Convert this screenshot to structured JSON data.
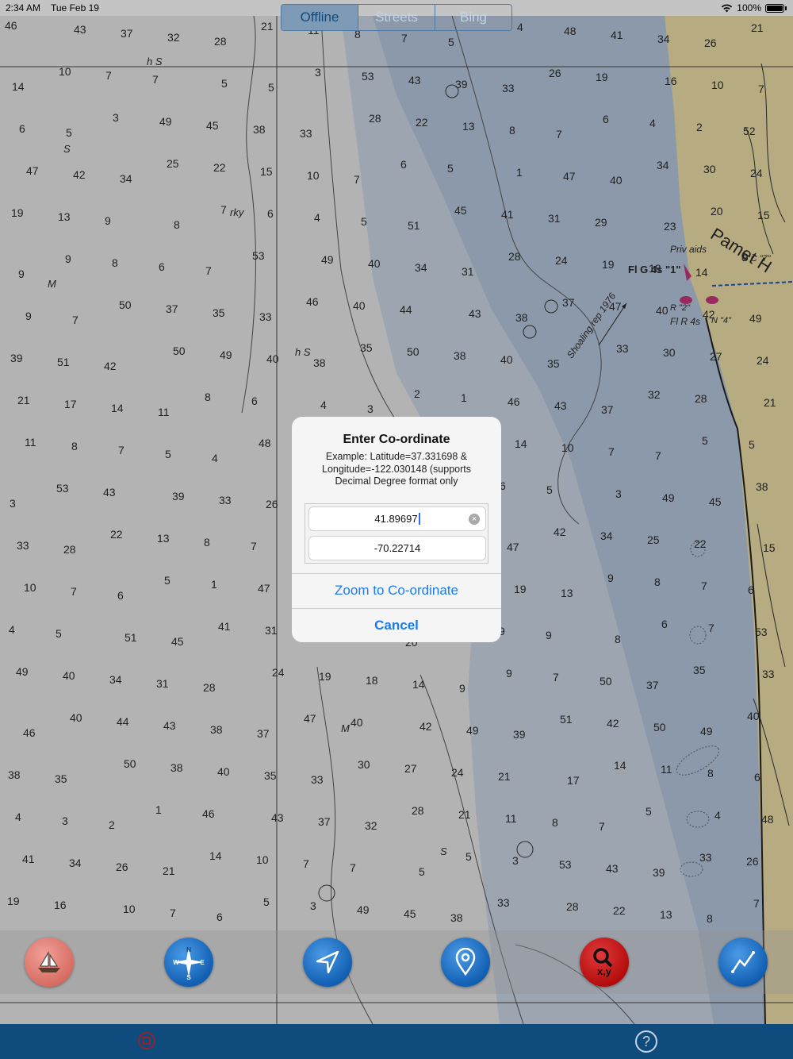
{
  "status_bar": {
    "time": "2:34 AM",
    "date": "Tue Feb 19",
    "battery": "100%"
  },
  "map": {
    "chart_labels": {
      "priv_aids": "Priv aids",
      "light_green": "Fl G 4s \"1\"",
      "light_red": "Fl R 4s",
      "buoy_r2": "R \"2\"",
      "buoy_n4": "N \"4\"",
      "shoaling": "Shoaling rep 1976",
      "place": "Pamet H",
      "gc": "G C \"7\""
    },
    "soundings": [
      "46",
      "43",
      "37",
      "32",
      "28",
      "21",
      "11",
      "8",
      "7",
      "5",
      "4",
      "48",
      "41",
      "34",
      "26",
      "21",
      "14",
      "10",
      "7",
      "7",
      "5",
      "5",
      "3",
      "53",
      "43",
      "39",
      "33",
      "26",
      "19",
      "16",
      "10",
      "7",
      "6",
      "5",
      "3",
      "49",
      "45",
      "38",
      "33",
      "28",
      "22",
      "13",
      "8",
      "7",
      "6",
      "4",
      "2",
      "52",
      "47",
      "42",
      "34",
      "25",
      "22",
      "15",
      "10",
      "7",
      "6",
      "5",
      "1",
      "47",
      "40",
      "34",
      "30",
      "24",
      "19",
      "13",
      "9",
      "8",
      "7",
      "6",
      "4",
      "5",
      "51",
      "45",
      "41",
      "31",
      "29",
      "23",
      "20",
      "15",
      "9",
      "9",
      "8",
      "6",
      "7",
      "53",
      "49",
      "40",
      "34",
      "31",
      "28",
      "24",
      "19",
      "18",
      "14",
      "9",
      "9",
      "7",
      "50",
      "37",
      "35",
      "33",
      "46",
      "40",
      "44",
      "43",
      "38",
      "37",
      "47",
      "40",
      "42",
      "49",
      "39",
      "51",
      "42",
      "50",
      "49",
      "40",
      "38",
      "35",
      "50",
      "38",
      "40",
      "35",
      "33",
      "30",
      "27",
      "24",
      "21",
      "17",
      "14",
      "11",
      "8",
      "6",
      "4",
      "3",
      "2",
      "1"
    ],
    "mini": [
      "h S",
      "M",
      "S",
      "rky"
    ]
  },
  "toolbar": {
    "buttons": [
      {
        "name": "boat-icon"
      },
      {
        "name": "compass-icon"
      },
      {
        "name": "navigate-arrow-icon"
      },
      {
        "name": "map-pin-icon"
      },
      {
        "name": "xy-search-icon",
        "label": "x,y"
      },
      {
        "name": "route-icon"
      }
    ]
  },
  "bottom_bar": {
    "tabs": [
      "Offline",
      "Streets",
      "Bing"
    ],
    "active_tab": "Offline",
    "help": "?"
  },
  "dialog": {
    "title": "Enter Co-ordinate",
    "message": "Example: Latitude=37.331698 & Longitude=-122.030148 (supports Decimal Degree format only",
    "latitude_value": "41.89697",
    "longitude_value": "-70.22714",
    "zoom_button": "Zoom to Co-ordinate",
    "cancel_button": "Cancel"
  },
  "colors": {
    "accent": "#1a7cf0",
    "bar": "#104b7e",
    "deep_water": "#a6b8d1",
    "land": "#dccb93"
  }
}
